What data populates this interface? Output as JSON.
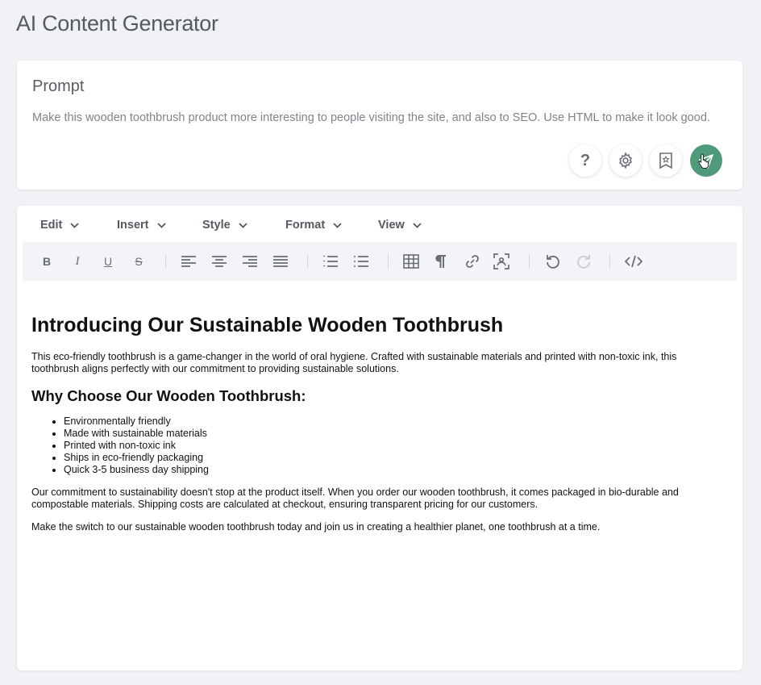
{
  "app": {
    "title": "AI Content Generator"
  },
  "prompt": {
    "label": "Prompt",
    "text": "Make this wooden toothbrush product more interesting to people visiting the site, and also to SEO.  Use HTML to make it look good.",
    "help_label": "?"
  },
  "menu": {
    "edit": "Edit",
    "insert": "Insert",
    "style": "Style",
    "format": "Format",
    "view": "View"
  },
  "toolbar": {
    "bold": "B",
    "italic": "I",
    "underline": "U",
    "strike": "S"
  },
  "content": {
    "heading": "Introducing Our Sustainable Wooden Toothbrush",
    "intro": "This eco-friendly toothbrush is a game-changer in the world of oral hygiene. Crafted with sustainable materials and printed with non-toxic ink, this toothbrush aligns perfectly with our commitment to providing sustainable solutions.",
    "subheading": "Why Choose Our Wooden Toothbrush:",
    "bullets": [
      "Environmentally friendly",
      "Made with sustainable materials",
      "Printed with non-toxic ink",
      "Ships in eco-friendly packaging",
      "Quick 3-5 business day shipping"
    ],
    "para2": "Our commitment to sustainability doesn't stop at the product itself. When you order our wooden toothbrush, it comes packaged in bio-durable and compostable materials. Shipping costs are calculated at checkout, ensuring transparent pricing for our customers.",
    "para3": "Make the switch to our sustainable wooden toothbrush today and join us in creating a healthier planet, one toothbrush at a time."
  },
  "colors": {
    "accent": "#4f9a7a",
    "background": "#f1f2f5"
  },
  "icons": [
    "help-icon",
    "settings-icon",
    "bookmark-icon",
    "send-icon",
    "cursor-hand-icon"
  ]
}
